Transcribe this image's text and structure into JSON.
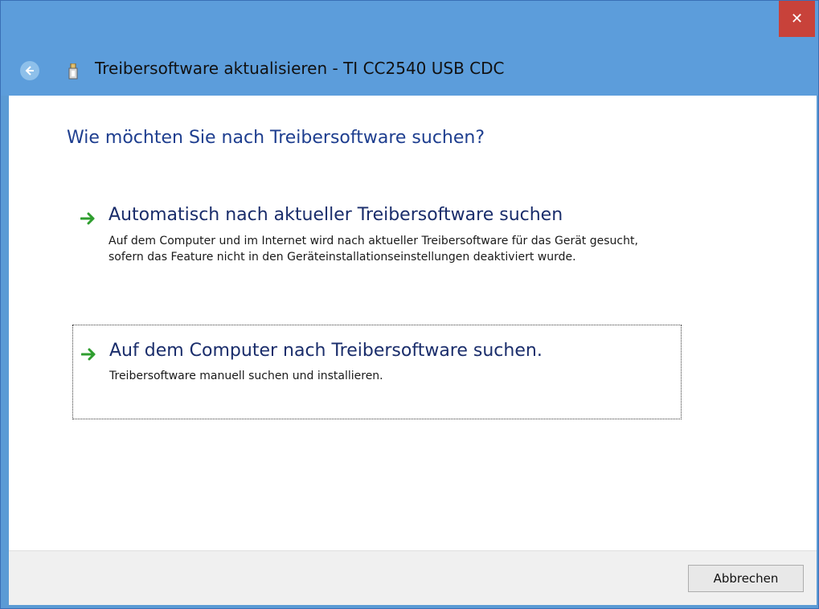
{
  "window": {
    "title": "Treibersoftware aktualisieren - TI CC2540 USB CDC",
    "close_glyph": "✕",
    "accent_color": "#5c9ddb",
    "close_color": "#c8423a"
  },
  "main": {
    "heading": "Wie möchten Sie nach Treibersoftware suchen?",
    "options": [
      {
        "icon": "green-arrow-icon",
        "title": "Automatisch nach aktueller Treibersoftware suchen",
        "description": "Auf dem Computer und im Internet wird nach aktueller Treibersoftware für das Gerät gesucht, sofern das Feature nicht in den Geräteinstallationseinstellungen deaktiviert wurde."
      },
      {
        "icon": "green-arrow-icon",
        "title": "Auf dem Computer nach Treibersoftware suchen.",
        "description": "Treibersoftware manuell suchen und installieren."
      }
    ]
  },
  "footer": {
    "cancel_label": "Abbrechen"
  }
}
